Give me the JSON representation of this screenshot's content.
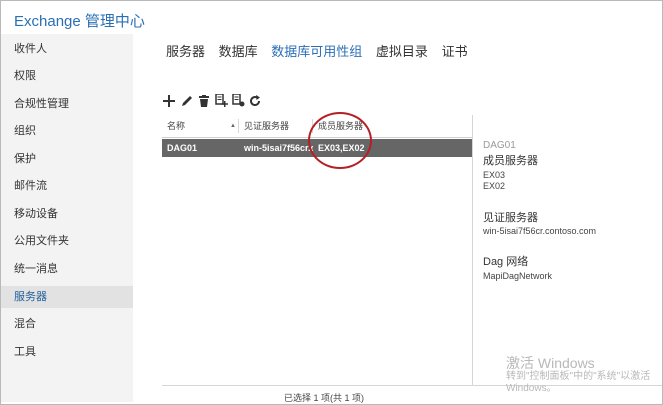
{
  "app": {
    "title": "Exchange 管理中心"
  },
  "sidebar": {
    "items": [
      {
        "label": "收件人"
      },
      {
        "label": "权限"
      },
      {
        "label": "合规性管理"
      },
      {
        "label": "组织"
      },
      {
        "label": "保护"
      },
      {
        "label": "邮件流"
      },
      {
        "label": "移动设备"
      },
      {
        "label": "公用文件夹"
      },
      {
        "label": "统一消息"
      },
      {
        "label": "服务器",
        "active": true
      },
      {
        "label": "混合"
      },
      {
        "label": "工具"
      }
    ]
  },
  "tabs": [
    {
      "label": "服务器"
    },
    {
      "label": "数据库"
    },
    {
      "label": "数据库可用性组",
      "active": true
    },
    {
      "label": "虚拟目录"
    },
    {
      "label": "证书"
    }
  ],
  "toolbar": {
    "icons": [
      "add-icon",
      "edit-icon",
      "delete-icon",
      "manage-membership-icon",
      "configure-network-icon",
      "refresh-icon"
    ]
  },
  "grid": {
    "columns": [
      "名称",
      "见证服务器",
      "成员服务器"
    ],
    "rows": [
      {
        "name": "DAG01",
        "witness": "win-5isai7f56cr.c...",
        "members": "EX03,EX02"
      }
    ]
  },
  "details": {
    "title": "DAG01",
    "members_heading": "成员服务器",
    "members": [
      "EX03",
      "EX02"
    ],
    "witness_heading": "见证服务器",
    "witness_value": "win-5isai7f56cr.contoso.com",
    "network_heading": "Dag 网络",
    "network_value": "MapiDagNetwork"
  },
  "status": {
    "text": "已选择 1 项(共 1 项)"
  },
  "watermark": {
    "title": "激活 Windows",
    "subtitle": "转到\"控制面板\"中的\"系统\"以激活 Windows。"
  },
  "colors": {
    "accent": "#2a6fb5",
    "selected_row": "#666666",
    "annotation": "#b52025"
  }
}
